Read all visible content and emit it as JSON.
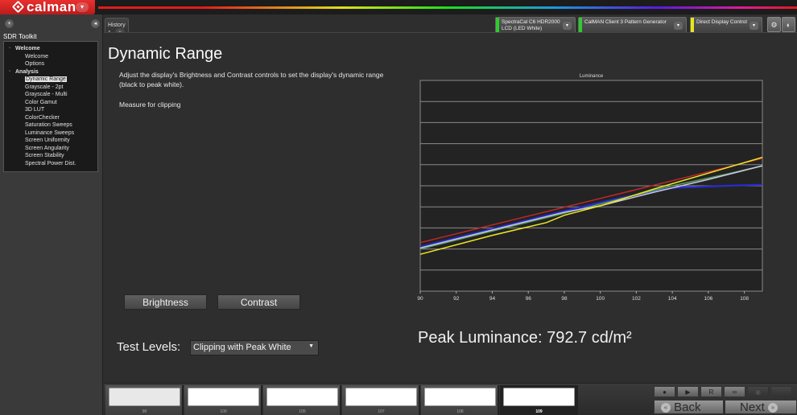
{
  "app": {
    "brand": "calman",
    "toolkit_title": "SDR Toolkit"
  },
  "tabs": [
    {
      "label": "History 1"
    }
  ],
  "devices": [
    {
      "line1": "SpectraCal C6 HDR2000",
      "line2": "LCD (LED White)",
      "status_color": "#2ecc2e"
    },
    {
      "line1": "CalMAN Client 3 Pattern Generator",
      "line2": "",
      "status_color": "#2ecc2e"
    },
    {
      "line1": "Direct Display Control",
      "line2": "",
      "status_color": "#e6e61e"
    }
  ],
  "sidebar": {
    "tree": [
      {
        "label": "Welcome",
        "type": "group"
      },
      {
        "label": "Welcome",
        "type": "child"
      },
      {
        "label": "Options",
        "type": "child"
      },
      {
        "label": "Analysis",
        "type": "group"
      },
      {
        "label": "Dynamic Range",
        "type": "child",
        "selected": true
      },
      {
        "label": "Grayscale - 2pt",
        "type": "child"
      },
      {
        "label": "Grayscale - Multi",
        "type": "child"
      },
      {
        "label": "Color Gamut",
        "type": "child"
      },
      {
        "label": "3D LUT",
        "type": "child"
      },
      {
        "label": "ColorChecker",
        "type": "child"
      },
      {
        "label": "Saturation Sweeps",
        "type": "child"
      },
      {
        "label": "Luminance Sweeps",
        "type": "child"
      },
      {
        "label": "Screen Uniformity",
        "type": "child"
      },
      {
        "label": "Screen Angularity",
        "type": "child"
      },
      {
        "label": "Screen Stability",
        "type": "child"
      },
      {
        "label": "Spectral Power Dist.",
        "type": "child"
      }
    ]
  },
  "main": {
    "title": "Dynamic Range",
    "description": "Adjust the display's Brightness and Contrast controls to set the display's dynamic range (black to peak white).",
    "measure_note": "Measure for clipping",
    "brightness_label": "Brightness",
    "contrast_label": "Contrast",
    "test_levels_label": "Test Levels:",
    "test_levels_value": "Clipping with Peak White",
    "peak_luminance_text": "Peak Luminance: 792.7  cd/m²"
  },
  "chart_data": {
    "type": "line",
    "title": "Luminance",
    "xlabel": "",
    "ylabel": "",
    "x_ticks": [
      90,
      92,
      94,
      96,
      98,
      100,
      102,
      104,
      106,
      108
    ],
    "xlim": [
      90,
      109
    ],
    "ylim": [
      0,
      10
    ],
    "y_grid_divisions": 10,
    "y_tick_labels_visible": false,
    "grid": true,
    "series": [
      {
        "name": "Red",
        "color": "#c0282a",
        "x": [
          90,
          95,
          100,
          105,
          109
        ],
        "values": [
          2.3,
          3.35,
          4.4,
          5.45,
          6.3
        ]
      },
      {
        "name": "Blue",
        "color": "#2a2ad2",
        "x": [
          90,
          94,
          98,
          101,
          104,
          107,
          109
        ],
        "values": [
          2.1,
          2.95,
          3.8,
          4.4,
          4.9,
          5.0,
          5.05
        ]
      },
      {
        "name": "Green",
        "color": "#5aa05a",
        "x": [
          90,
          94,
          98,
          101,
          104,
          107,
          109
        ],
        "values": [
          2.0,
          2.85,
          3.7,
          4.35,
          5.0,
          5.55,
          5.95
        ]
      },
      {
        "name": "Luminance",
        "color": "#c8c8e6",
        "x": [
          90,
          94,
          98,
          100,
          103,
          106,
          109
        ],
        "values": [
          2.05,
          2.9,
          3.75,
          4.05,
          4.7,
          5.3,
          5.95
        ]
      },
      {
        "name": "Yellow",
        "color": "#f0e628",
        "x": [
          90,
          94,
          97,
          98,
          100,
          103,
          106,
          109
        ],
        "values": [
          1.75,
          2.65,
          3.25,
          3.6,
          4.05,
          4.85,
          5.6,
          6.35
        ]
      }
    ]
  },
  "bottom": {
    "swatches": [
      {
        "label": "90",
        "active": false
      },
      {
        "label": "100",
        "active": false
      },
      {
        "label": "105",
        "active": false
      },
      {
        "label": "107",
        "active": false
      },
      {
        "label": "108",
        "active": false
      },
      {
        "label": "109",
        "active": true
      }
    ],
    "back_label": "Back",
    "next_label": "Next"
  }
}
